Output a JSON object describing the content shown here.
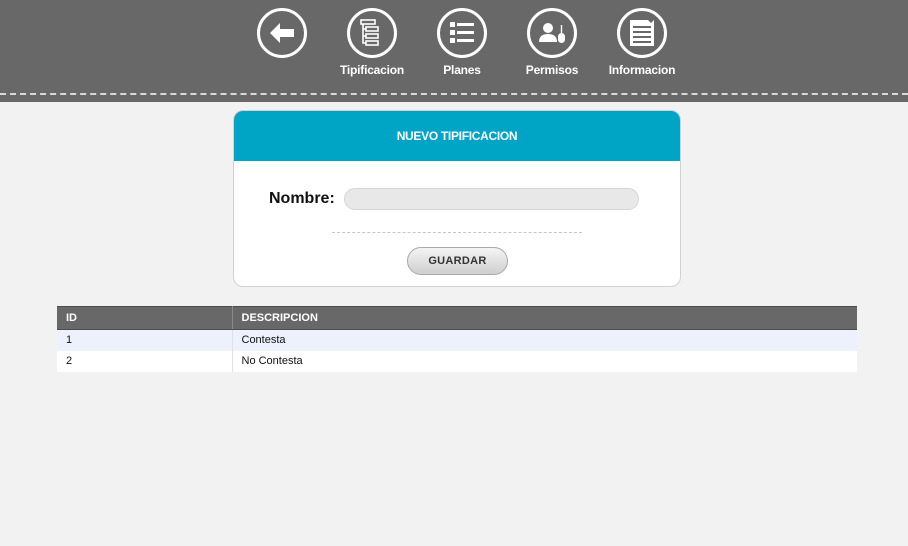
{
  "nav": {
    "items": [
      {
        "label": "",
        "icon": "back-arrow-icon"
      },
      {
        "label": "Tipificacion",
        "icon": "tree-list-icon"
      },
      {
        "label": "Planes",
        "icon": "bullet-list-icon"
      },
      {
        "label": "Permisos",
        "icon": "user-mouse-icon"
      },
      {
        "label": "Informacion",
        "icon": "document-icon"
      }
    ]
  },
  "form": {
    "title": "NUEVO TIPIFICACION",
    "name_label": "Nombre:",
    "name_value": "",
    "save_label": "GUARDAR"
  },
  "table": {
    "headers": [
      "ID",
      "DESCRIPCION"
    ],
    "rows": [
      [
        "1",
        "Contesta"
      ],
      [
        "2",
        "No Contesta"
      ]
    ]
  },
  "colors": {
    "topbar": "#686868",
    "accent": "#00a4c5",
    "row_alt": "#ecf1fb"
  }
}
